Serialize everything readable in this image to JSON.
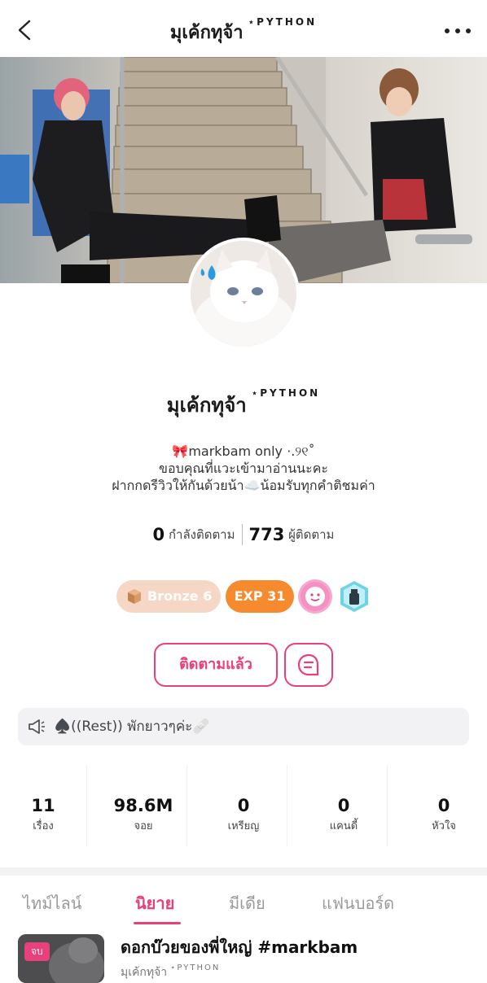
{
  "header": {
    "title": "มุเค้กทุจ้า",
    "title_sup": "⋆PYTHON",
    "back_icon": "chevron-left-icon",
    "more_icon": "more-horizontal-icon"
  },
  "profile": {
    "name": "มุเค้กทุจ้า",
    "name_sup": "⋆PYTHON",
    "bio_line1": "🎀markbam only ⋅.୨୧˚",
    "bio_line2": "ขอบคุณที่แวะเข้ามาอ่านนะคะ",
    "bio_line3": "ฝากกดรีวิวให้กันด้วยน้า☁️น้อมรับทุกคำติชมค่า",
    "following_count": "0",
    "following_label": "กำลังติดตาม",
    "followers_count": "773",
    "followers_label": "ผู้ติดตาม"
  },
  "badges": {
    "bronze_label": "Bronze 6",
    "exp_label": "EXP 31",
    "colors": {
      "bronze_bg": "#f6d7c6",
      "exp_bg": "#f68a2e"
    }
  },
  "actions": {
    "follow_label": "ติดตามแล้ว",
    "chat_icon": "chat-bubble-icon"
  },
  "announcement": {
    "icon": "megaphone-icon",
    "text": "♠️((Rest)) พักยาวๆค่ะ🩹"
  },
  "stats": [
    {
      "value": "11",
      "label": "เรื่อง"
    },
    {
      "value": "98.6M",
      "label": "จอย"
    },
    {
      "value": "0",
      "label": "เหรียญ"
    },
    {
      "value": "0",
      "label": "แคนดี้"
    },
    {
      "value": "0",
      "label": "หัวใจ"
    }
  ],
  "tabs": [
    {
      "label": "ไทม์ไลน์",
      "active": false
    },
    {
      "label": "นิยาย",
      "active": true
    },
    {
      "label": "มีเดีย",
      "active": false
    },
    {
      "label": "แฟนบอร์ด",
      "active": false
    }
  ],
  "story": {
    "tag": "จบ",
    "title": "ดอกบ๊วยของพี่ใหญ่ #markbam",
    "author": "มุเค้กทุจ้า",
    "author_sup": "⋆PYTHON"
  },
  "theme": {
    "accent": "#e8407a"
  }
}
